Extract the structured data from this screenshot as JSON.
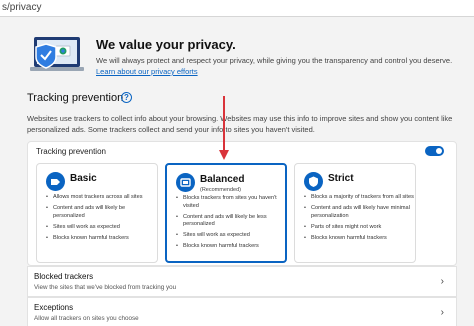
{
  "address_bar": {
    "url_fragment": "s/privacy"
  },
  "hero": {
    "title": "We value your privacy.",
    "description": "We will always protect and respect your privacy, while giving you the transparency and control you deserve.",
    "link_text": "Learn about our privacy efforts",
    "illustration_icon": "shield-laptop-illustration"
  },
  "tracking": {
    "heading": "Tracking prevention",
    "help_icon": "question-circle-icon",
    "description": "Websites use trackers to collect info about your browsing. Websites may use this info to improve sites and show you content like personalized ads. Some trackers collect and send your info to sites you haven't visited.",
    "panel_label": "Tracking prevention",
    "toggle_on": true,
    "accent_color": "#0a64c2"
  },
  "cards": [
    {
      "title": "Basic",
      "subtitle": "",
      "selected": false,
      "icon": "basic-icon",
      "bullets": [
        "Allows most trackers across all sites",
        "Content and ads will likely be personalized",
        "Sites will work as expected",
        "Blocks known harmful trackers"
      ]
    },
    {
      "title": "Balanced",
      "subtitle": "(Recommended)",
      "selected": true,
      "icon": "balanced-icon",
      "bullets": [
        "Blocks trackers from sites you haven't visited",
        "Content and ads will likely be less personalized",
        "Sites will work as expected",
        "Blocks known harmful trackers"
      ]
    },
    {
      "title": "Strict",
      "subtitle": "",
      "selected": false,
      "icon": "strict-icon",
      "bullets": [
        "Blocks a majority of trackers from all sites",
        "Content and ads will likely have minimal personalization",
        "Parts of sites might not work",
        "Blocks known harmful trackers"
      ]
    }
  ],
  "blocked": {
    "title": "Blocked trackers",
    "description": "View the sites that we've blocked from tracking you"
  },
  "exceptions": {
    "title": "Exceptions",
    "description": "Allow all trackers on sites you choose"
  },
  "annotation_color": "#d9333a"
}
